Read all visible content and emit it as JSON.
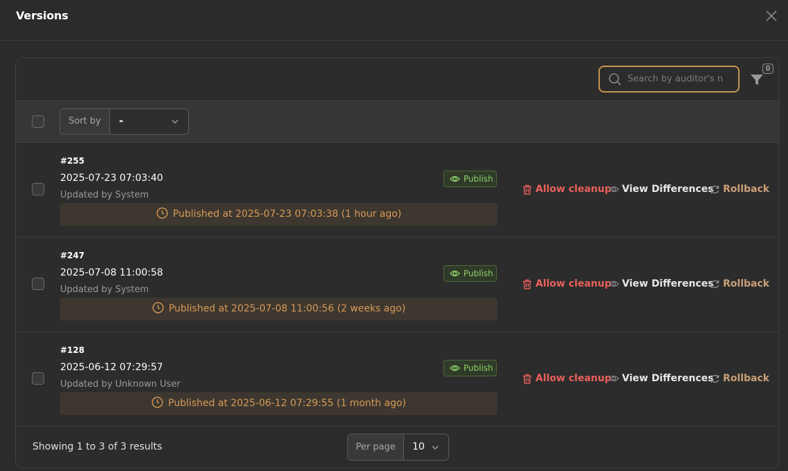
{
  "modal": {
    "title": "Versions",
    "close_icon": "close-icon"
  },
  "toolbar": {
    "search_placeholder": "Search by auditor's name",
    "filter_count": "0",
    "filter_icon": "funnel-icon"
  },
  "sort": {
    "label": "Sort by",
    "value": "-"
  },
  "versions": [
    {
      "id": "#255",
      "date": "2025-07-23 07:03:40",
      "updated_by": "Updated by System",
      "badge": "Publish",
      "published": "Published at 2025-07-23 07:03:38 (1 hour ago)"
    },
    {
      "id": "#247",
      "date": "2025-07-08 11:00:58",
      "updated_by": "Updated by System",
      "badge": "Publish",
      "published": "Published at 2025-07-08 11:00:56 (2 weeks ago)"
    },
    {
      "id": "#128",
      "date": "2025-06-12 07:29:57",
      "updated_by": "Updated by Unknown User",
      "badge": "Publish",
      "published": "Published at 2025-06-12 07:29:55 (1 month ago)"
    }
  ],
  "actions": {
    "cleanup": "Allow cleanup",
    "diff": "View Differences",
    "rollback": "Rollback"
  },
  "footer": {
    "results": "Showing 1 to 3 of 3 results",
    "per_page_label": "Per page",
    "per_page_value": "10"
  },
  "colors": {
    "accent": "#c8954f",
    "danger": "#e8605a",
    "success": "#8fcf6a",
    "rollback": "#c99f77",
    "published": "#d89a55"
  }
}
